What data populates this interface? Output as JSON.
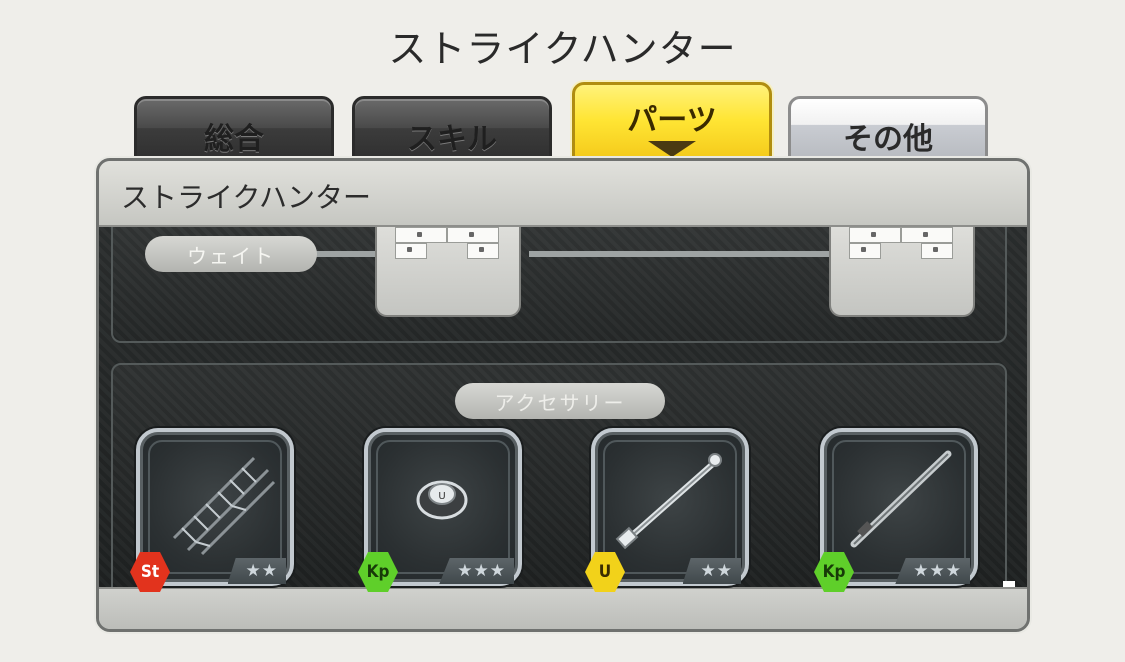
{
  "screen_title": "ストライクハンター",
  "tabs": [
    {
      "label": "総合",
      "active": false
    },
    {
      "label": "スキル",
      "active": false
    },
    {
      "label": "パーツ",
      "active": true
    },
    {
      "label": "その他",
      "active": false
    }
  ],
  "panel": {
    "header": "ストライクハンター",
    "weight_section": {
      "label": "ウェイト"
    },
    "accessory_section": {
      "label": "アクセサリー",
      "items": [
        {
          "badge": "St",
          "badge_color": "#e2331d",
          "stars": "★★",
          "icon": "rail-part-icon"
        },
        {
          "badge": "Kp",
          "badge_color": "#5fcf2a",
          "stars": "★★★",
          "icon": "gear-nut-icon"
        },
        {
          "badge": "U",
          "badge_color": "#f2d21a",
          "stars": "★★",
          "icon": "rod-part-icon"
        },
        {
          "badge": "Kp",
          "badge_color": "#5fcf2a",
          "stars": "★★★",
          "icon": "shaft-part-icon"
        }
      ]
    }
  },
  "colors": {
    "active_tab": "#ffe534",
    "background": "#efeeea"
  }
}
